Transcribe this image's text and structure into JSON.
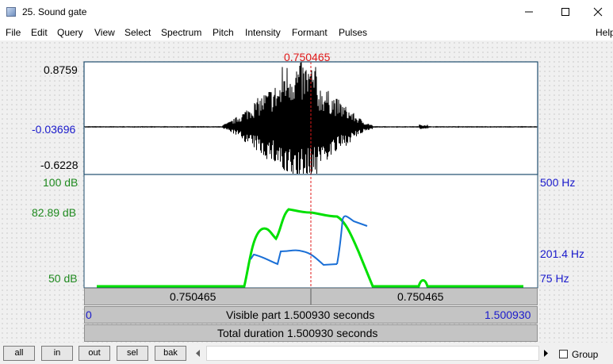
{
  "window": {
    "title": "25. Sound gate"
  },
  "menu": [
    "File",
    "Edit",
    "Query",
    "View",
    "Select",
    "Spectrum",
    "Pitch",
    "Intensity",
    "Formant",
    "Pulses",
    "Help"
  ],
  "cursor": {
    "time": "0.750465"
  },
  "waveform": {
    "max": "0.8759",
    "mean": "-0.03696",
    "min": "-0.6228"
  },
  "intensity": {
    "top": "100 dB",
    "mid": "82.89 dB",
    "bottom": "50 dB"
  },
  "pitch": {
    "top": "500 Hz",
    "mid": "201.4 Hz",
    "bottom": "75 Hz"
  },
  "segments": {
    "left": "0.750465",
    "right": "0.750465"
  },
  "visible": {
    "start": "0",
    "end": "1.500930",
    "label": "Visible part 1.500930 seconds"
  },
  "total": {
    "label": "Total duration 1.500930 seconds"
  },
  "toolbar": {
    "all": "all",
    "in": "in",
    "out": "out",
    "sel": "sel",
    "bak": "bak",
    "group": "Group"
  },
  "colors": {
    "waveform": "#000000",
    "intensity": "#00e000",
    "pitch": "#1a6fd6",
    "cursor": "#e01818",
    "frame": "#1f4e6e"
  }
}
